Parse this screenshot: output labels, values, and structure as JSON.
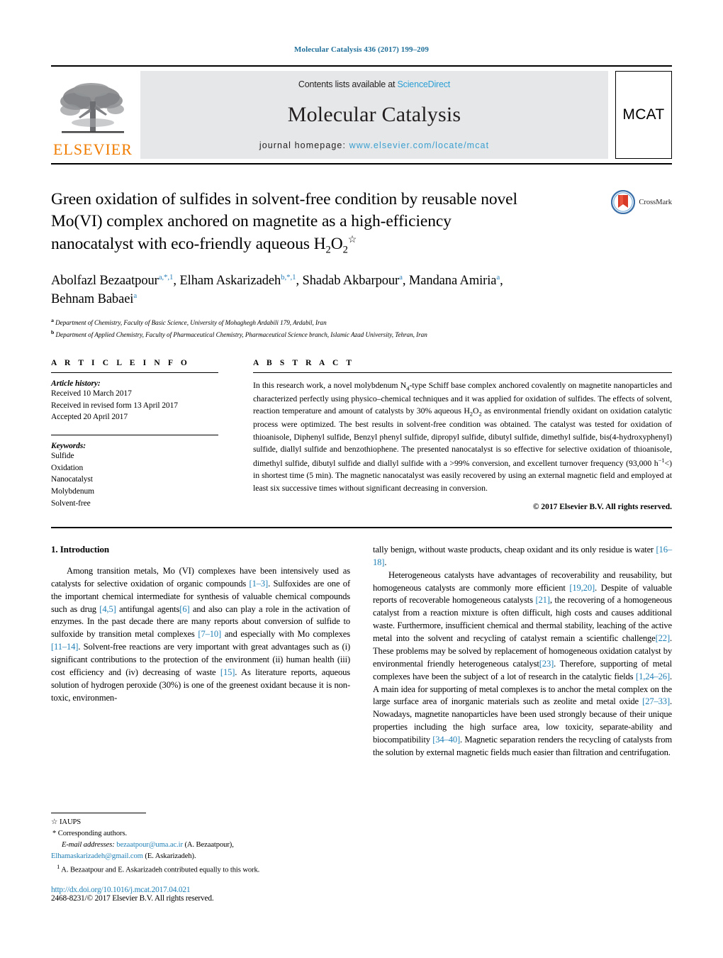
{
  "running_head": "Molecular Catalysis 436 (2017) 199–209",
  "masthead": {
    "publisher_name": "ELSEVIER",
    "contents_prefix": "Contents lists available at ",
    "contents_link": "ScienceDirect",
    "journal_title": "Molecular Catalysis",
    "homepage_prefix": "journal homepage: ",
    "homepage_url": "www.elsevier.com/locate/mcat",
    "journal_badge": "MCAT",
    "colors": {
      "elsevier_orange": "#F07C00",
      "link_blue": "#2a9fd6",
      "banner_grey": "#e6e7e8"
    }
  },
  "article": {
    "title_line1": "Green oxidation of sulfides in solvent-free condition by reusable novel",
    "title_line2": "Mo(VI) complex anchored on magnetite as a high-efficiency",
    "title_line3_pre": "nanocatalyst with eco-friendly aqueous H",
    "title_sub": "2",
    "title_o": "O",
    "title_sub2": "2",
    "title_star": "☆",
    "crossmark_label": "CrossMark",
    "authors_line1": "Abolfazl Bezaatpour",
    "authors_line1_sup": "a,*,1",
    "authors_2": "Elham Askarizadeh",
    "authors_2_sup": "b,*,1",
    "authors_3": "Shadab Akbarpour",
    "authors_3_sup": "a",
    "authors_4": "Mandana Amiria",
    "authors_4_sup": "a",
    "authors_5": "Behnam Babaei",
    "authors_5_sup": "a",
    "affiliation_a": "Department of Chemistry, Faculty of Basic Science, University of Mohaghegh Ardabili 179, Ardabil, Iran",
    "affiliation_b": "Department of Applied Chemistry, Faculty of Pharmaceutical Chemistry, Pharmaceutical Science branch, Islamic Azad University, Tehran, Iran"
  },
  "article_info": {
    "heading": "A R T I C L E    I N F O",
    "history_label": "Article history:",
    "history": [
      "Received 10 March 2017",
      "Received in revised form 13 April 2017",
      "Accepted 20 April 2017"
    ],
    "keywords_label": "Keywords:",
    "keywords": [
      "Sulfide",
      "Oxidation",
      "Nanocatalyst",
      "Molybdenum",
      "Solvent-free"
    ]
  },
  "abstract": {
    "heading": "A B S T R A C T",
    "part1": "In this research work, a novel molybdenum N",
    "sub1": "4",
    "part2": "-type Schiff base complex anchored covalently on magnetite nanoparticles and characterized perfectly using physico–chemical techniques and it was applied for oxidation of sulfides. The effects of solvent, reaction temperature and amount of catalysts by 30% aqueous H",
    "sub2": "2",
    "part3": "O",
    "sub3": "2",
    "part4": " as environmental friendly oxidant on oxidation catalytic process were optimized. The best results in solvent-free condition was obtained. The catalyst was tested for oxidation of thioanisole, Diphenyl sulfide, Benzyl phenyl sulfide, dipropyl sulfide, dibutyl sulfide, dimethyl sulfide, bis(4-hydroxyphenyl) sulfide, diallyl sulfide and benzothiophene. The presented nanocatalyst is so effective for selective oxidation of thioanisole, dimethyl sulfide, dibutyl sulfide and diallyl sulfide with a >99% conversion, and excellent turnover frequency (93,000 h",
    "sup1": "−1",
    "part5": "<) in shortest time (5 min). The magnetic nanocatalyst was easily recovered by using an external magnetic field and employed at least six successive times without significant decreasing in conversion.",
    "copyright": "© 2017 Elsevier B.V. All rights reserved."
  },
  "introduction": {
    "section_title": "1.  Introduction",
    "left_p1_a": "Among transition metals, Mo (VI) complexes have been intensively used as catalysts for selective oxidation of organic compounds ",
    "left_ref1": "[1–3]",
    "left_p1_b": ". Sulfoxides are one of the important chemical intermediate for synthesis of valuable chemical compounds such as drug ",
    "left_ref2": "[4,5]",
    "left_p1_c": " antifungal agents",
    "left_ref3": "[6]",
    "left_p1_d": " and also can play a role in the activation of enzymes. In the past decade there are many reports about conversion of sulfide to sulfoxide by transition metal complexes ",
    "left_ref4": "[7–10]",
    "left_p1_e": " and especially with Mo complexes ",
    "left_ref5": "[11–14]",
    "left_p1_f": ". Solvent-free reactions are very important with great advantages such as (i) significant contributions to the protection of the environment (ii) human health (iii) cost efficiency and (iv) decreasing of waste ",
    "left_ref6": "[15]",
    "left_p1_g": ". As literature reports, aqueous solution of hydrogen peroxide (30%) is one of the greenest oxidant because it is non-toxic, environmen-",
    "right_p1_a": "tally benign, without waste products, cheap oxidant and its only residue is water ",
    "right_ref1": "[16–18]",
    "right_p1_b": ".",
    "right_p2_a": "Heterogeneous catalysts have advantages of recoverability and reusability, but homogeneous catalysts are commonly more efficient ",
    "right_ref2": "[19,20]",
    "right_p2_b": ". Despite of valuable reports of recoverable homogeneous catalysts ",
    "right_ref3": "[21]",
    "right_p2_c": ", the recovering of a homogeneous catalyst from a reaction mixture is often difficult, high costs and causes additional waste. Furthermore, insufficient chemical and thermal stability, leaching of the active metal into the solvent and recycling of catalyst remain a scientific challenge",
    "right_ref4": "[22]",
    "right_p2_d": ". These problems may be solved by replacement of homogeneous oxidation catalyst by environmental friendly heterogeneous catalyst",
    "right_ref5": "[23]",
    "right_p2_e": ". Therefore, supporting of metal complexes have been the subject of a lot of research in the catalytic fields ",
    "right_ref6": "[1,24–26]",
    "right_p2_f": ". A main idea for supporting of metal complexes is to anchor the metal complex on the large surface area of inorganic materials such as zeolite and metal oxide ",
    "right_ref7": "[27–33]",
    "right_p2_g": ". Nowadays, magnetite nanoparticles have been used strongly because of their unique properties including the high surface area, low toxicity, separate-ability and biocompatibility ",
    "right_ref8": "[34–40]",
    "right_p2_h": ". Magnetic separation renders the recycling of catalysts from the solution by external magnetic fields much easier than filtration and centrifugation."
  },
  "footnotes": {
    "star_symbol": "☆",
    "star_text": "IAUPS",
    "asterisk_symbol": "*",
    "asterisk_text": "Corresponding authors.",
    "email_label": "E-mail addresses:",
    "email_1": "bezaatpour@uma.ac.ir",
    "email_1_owner": "(A. Bezaatpour),",
    "email_2": "Elhamaskarizadeh@gmail.com",
    "email_2_owner": "(E. Askarizadeh).",
    "note_marker": "1",
    "note_text": "A. Bezaatpour and E. Askarizadeh contributed equally to this work.",
    "doi": "http://dx.doi.org/10.1016/j.mcat.2017.04.021",
    "issn": "2468-8231/© 2017 Elsevier B.V. All rights reserved."
  }
}
